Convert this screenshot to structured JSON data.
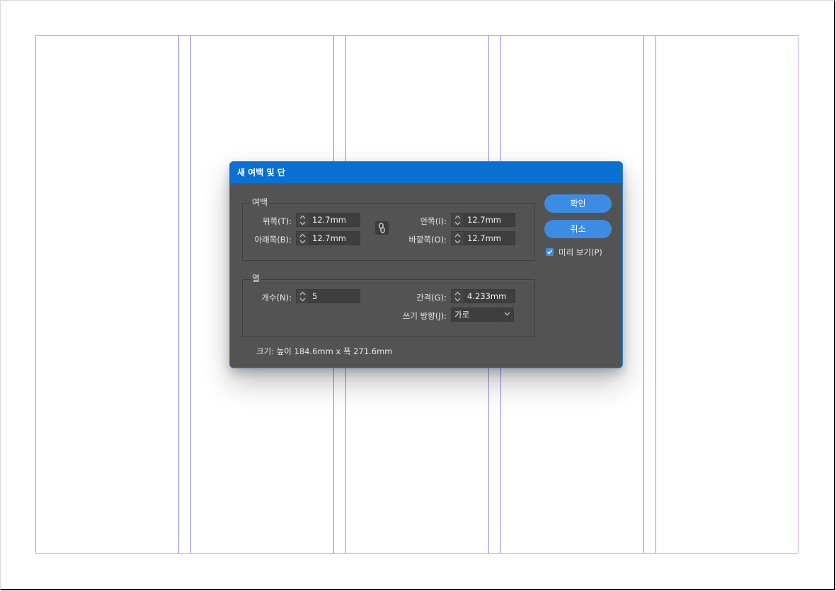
{
  "dialog": {
    "title": "새 여백 및 단",
    "margins": {
      "title": "여백",
      "top_label": "위쪽(T):",
      "top_value": "12.7mm",
      "bottom_label": "아래쪽(B):",
      "bottom_value": "12.7mm",
      "inside_label": "안쪽(I):",
      "inside_value": "12.7mm",
      "outside_label": "바깥쪽(O):",
      "outside_value": "12.7mm"
    },
    "columns": {
      "title": "열",
      "number_label": "개수(N):",
      "number_value": "5",
      "gutter_label": "간격(G):",
      "gutter_value": "4.233mm",
      "direction_label": "쓰기 방향(J):",
      "direction_value": "가로"
    },
    "size_text": "크기:  높이 184.6mm x 폭 271.6mm",
    "ok_label": "확인",
    "cancel_label": "취소",
    "preview_label": "미리 보기(P)",
    "preview_checked": true
  },
  "colors": {
    "titlebar": "#0a70d2",
    "dialog_bg": "#535353",
    "button": "#3c8ce4",
    "margin_guide": "#c79ad9",
    "column_guide": "#8f8fe8"
  },
  "icons": {
    "link": "chain-link-icon",
    "spinner": "up-down-arrows-icon",
    "dropdown": "chevron-down-icon",
    "check": "checkmark-icon"
  }
}
